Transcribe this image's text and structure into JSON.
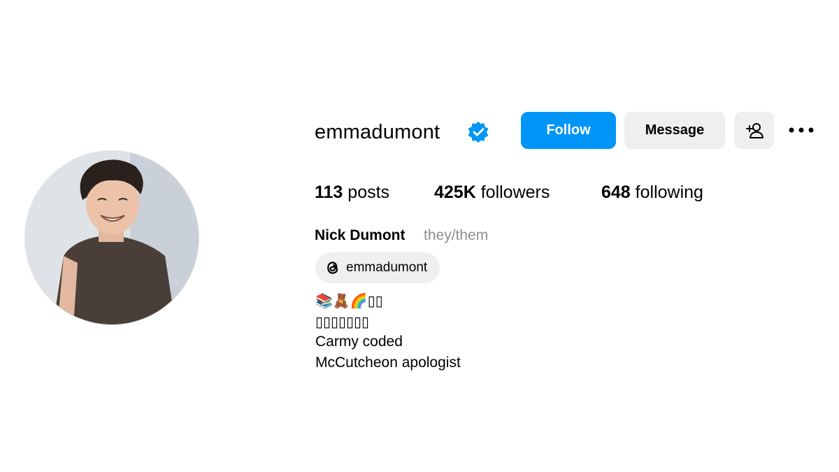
{
  "profile": {
    "username": "emmadumont",
    "verified_color": "#0095f6",
    "full_name": "Nick Dumont",
    "pronouns": "they/them",
    "threads_handle": "emmadumont",
    "avatar_icon": "profile-photo"
  },
  "actions": {
    "follow_label": "Follow",
    "message_label": "Message",
    "add_user_icon": "add-user-icon",
    "more_icon": "more-options-icon"
  },
  "stats": {
    "posts_count": "113",
    "posts_label": "posts",
    "followers_count": "425K",
    "followers_label": "followers",
    "following_count": "648",
    "following_label": "following"
  },
  "bio": {
    "line1": "📚🧸🌈▯▯",
    "line2": "▯▯▯▯▯▯▯",
    "line3": "Carmy coded",
    "line4": "McCutcheon apologist"
  },
  "colors": {
    "accent": "#0095f6",
    "secondary_button": "#efefef",
    "muted_text": "#8e8e8e"
  }
}
